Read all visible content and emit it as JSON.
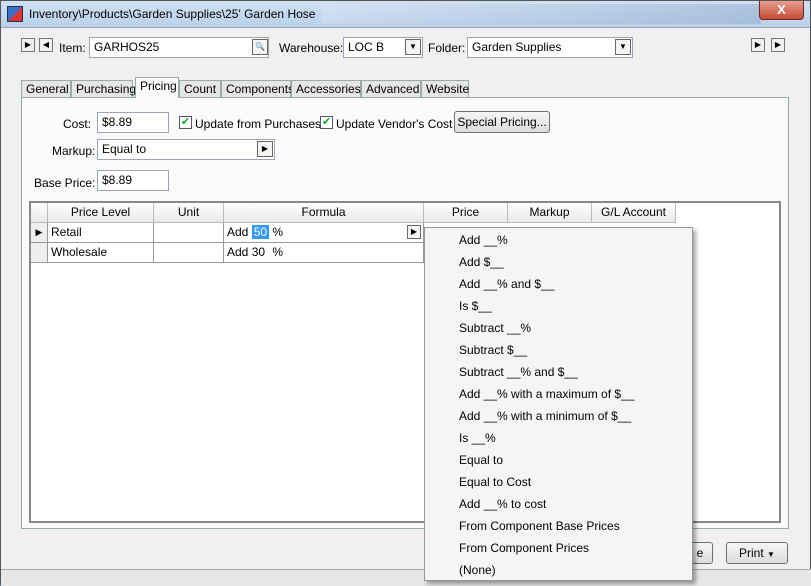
{
  "window": {
    "title": "Inventory\\Products\\Garden Supplies\\25' Garden Hose",
    "close_label": "X"
  },
  "item_bar": {
    "item_label": "Item:",
    "item_value": "GARHOS25",
    "warehouse_label": "Warehouse:",
    "warehouse_value": "LOC B",
    "folder_label": "Folder:",
    "folder_value": "Garden Supplies"
  },
  "tabs": [
    {
      "label": "General"
    },
    {
      "label": "Purchasing"
    },
    {
      "label": "Pricing"
    },
    {
      "label": "Count"
    },
    {
      "label": "Components"
    },
    {
      "label": "Accessories"
    },
    {
      "label": "Advanced"
    },
    {
      "label": "Website"
    }
  ],
  "pricing": {
    "cost_label": "Cost:",
    "cost_value": "$8.89",
    "update_from_purchases_label": "Update from Purchases",
    "update_from_purchases_checked": true,
    "update_vendor_cost_label": "Update Vendor's Cost",
    "update_vendor_cost_checked": true,
    "special_pricing_label": "Special Pricing...",
    "markup_label": "Markup:",
    "markup_value": "Equal to",
    "base_price_label": "Base Price:",
    "base_price_value": "$8.89"
  },
  "grid": {
    "columns": [
      "Price Level",
      "Unit",
      "Formula",
      "Price",
      "Markup",
      "G/L Account"
    ],
    "rows": [
      {
        "price_level": "Retail",
        "unit": "",
        "formula_prefix": "Add",
        "formula_value": "50",
        "formula_suffix": "%"
      },
      {
        "price_level": "Wholesale",
        "unit": "",
        "formula_prefix": "Add",
        "formula_value": "30",
        "formula_suffix": "%"
      }
    ]
  },
  "formula_menu": [
    "Add __%",
    "Add $__",
    "Add __% and $__",
    "Is $__",
    "Subtract __%",
    "Subtract $__",
    "Subtract __% and $__",
    "Add __% with a maximum of $__",
    "Add __% with a minimum of $__",
    "Is __%",
    "Equal to",
    "Equal to Cost",
    "Add __% to cost",
    "From Component Base Prices",
    "From Component Prices",
    "(None)"
  ],
  "footer": {
    "close_partial_label": "e",
    "print_label": "Print"
  },
  "colors": {
    "selection": "#3399ff",
    "titlebar": "#b9d1ea",
    "close_button": "#c54b34"
  }
}
